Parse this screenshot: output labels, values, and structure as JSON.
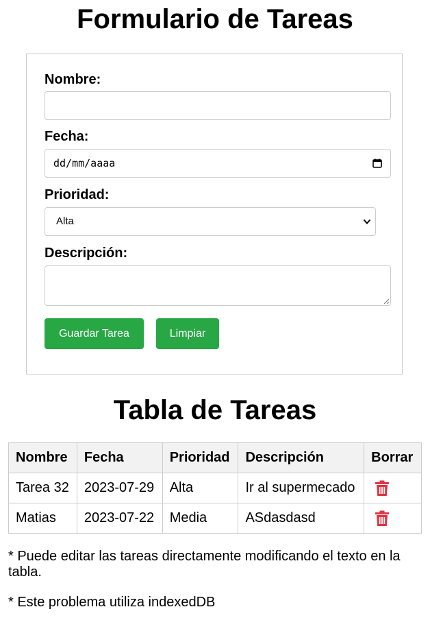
{
  "form": {
    "title": "Formulario de Tareas",
    "nombre_label": "Nombre:",
    "nombre_value": "",
    "fecha_label": "Fecha:",
    "fecha_placeholder": "dd/mm/aaaa",
    "prioridad_label": "Prioridad:",
    "prioridad_selected": "Alta",
    "descripcion_label": "Descripción:",
    "descripcion_value": "",
    "save_label": "Guardar Tarea",
    "clear_label": "Limpiar",
    "button_color": "#28a745"
  },
  "table": {
    "title": "Tabla de Tareas",
    "headers": [
      "Nombre",
      "Fecha",
      "Prioridad",
      "Descripción",
      "Borrar"
    ],
    "rows": [
      {
        "nombre": "Tarea 32",
        "fecha": "2023-07-29",
        "prioridad": "Alta",
        "descripcion": "Ir al supermecado",
        "borrar_icon": "trash-icon"
      },
      {
        "nombre": "Matias",
        "fecha": "2023-07-22",
        "prioridad": "Media",
        "descripcion": "ASdasdasd",
        "borrar_icon": "trash-icon"
      }
    ],
    "delete_color": "#dc3545"
  },
  "notes": {
    "edit_note": "* Puede editar las tareas directamente modificando el texto en la tabla.",
    "indexeddb_note": "* Este problema utiliza indexedDB"
  }
}
